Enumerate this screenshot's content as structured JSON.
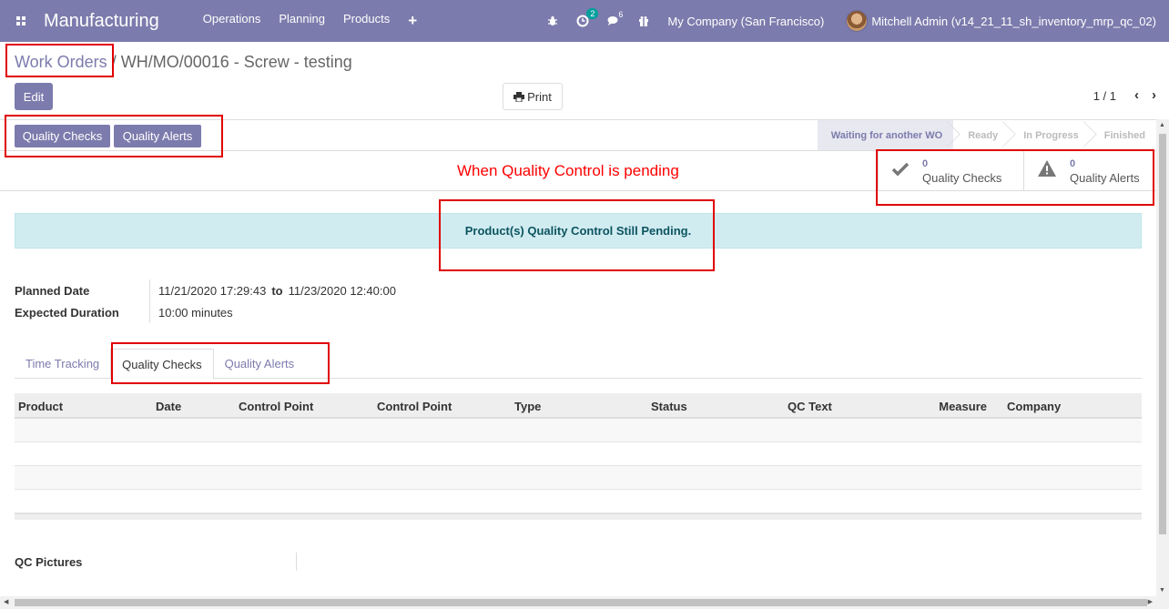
{
  "navbar": {
    "app_name": "Manufacturing",
    "menu": [
      "Operations",
      "Planning",
      "Products"
    ],
    "plus_icon": "+",
    "activity_badge": "2",
    "messages_badge": "6",
    "company": "My Company (San Francisco)",
    "user": "Mitchell Admin (v14_21_11_sh_inventory_mrp_qc_02)"
  },
  "breadcrumb": {
    "parent": "Work Orders",
    "separator": "/",
    "current": "WH/MO/00016 - Screw - testing"
  },
  "toolbar": {
    "edit_label": "Edit",
    "print_label": "Print",
    "pager": "1 / 1"
  },
  "header": {
    "quality_checks_label": "Quality Checks",
    "quality_alerts_label": "Quality Alerts",
    "stages": [
      "Waiting for another WO",
      "Ready",
      "In Progress",
      "Finished"
    ],
    "active_stage": "Waiting for another WO"
  },
  "annotation": "When Quality Control is pending",
  "smart_buttons": {
    "checks": {
      "count": "0",
      "label": "Quality Checks"
    },
    "alerts": {
      "count": "0",
      "label": "Quality Alerts"
    }
  },
  "alert_message": "Product(s) Quality Control Still Pending.",
  "fields": {
    "planned_date_label": "Planned Date",
    "planned_start": "11/21/2020 17:29:43",
    "to_label": "to",
    "planned_end": "11/23/2020 12:40:00",
    "duration_label": "Expected Duration",
    "duration_value": "10:00 minutes"
  },
  "tabs": [
    "Time Tracking",
    "Quality Checks",
    "Quality Alerts"
  ],
  "active_tab": "Quality Checks",
  "table": {
    "columns": [
      "Product",
      "Date",
      "Control Point",
      "Control Point",
      "Type",
      "Status",
      "QC Text",
      "Measure",
      "Company"
    ],
    "rows": []
  },
  "qc_pictures_label": "QC Pictures",
  "colors": {
    "brand": "#7c7bad",
    "annotation": "#ff0000",
    "alert_bg": "#d1ecf1"
  }
}
